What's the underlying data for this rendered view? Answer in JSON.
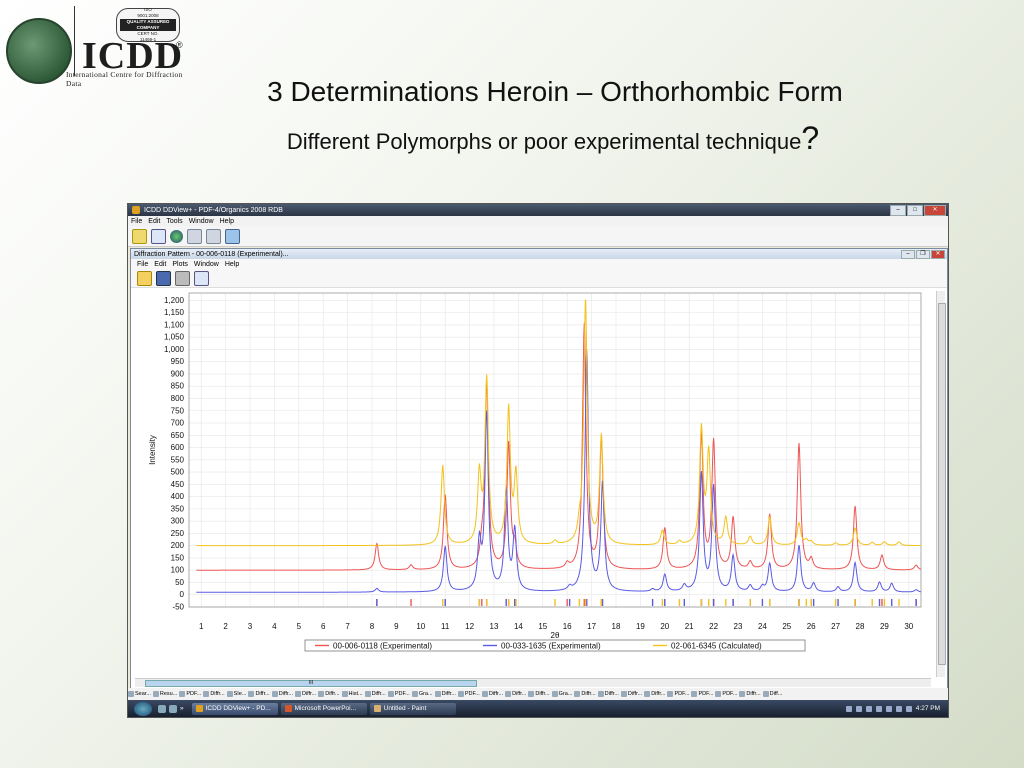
{
  "logo": {
    "brand": "ICDD",
    "tagline": "International Centre for Diffraction Data",
    "iso_badge": [
      "ISO",
      "9001:2008",
      "QUALITY ASSURED COMPANY",
      "CERT NO.",
      "11469-1"
    ]
  },
  "slide": {
    "title": "3 Determinations Heroin – Orthorhombic Form",
    "subtitle": "Different Polymorphs or poor experimental technique",
    "subtitle_mark": "?"
  },
  "app": {
    "title": "ICDD DDView+ - PDF-4/Organics 2008 RDB",
    "menu": [
      "File",
      "Edit",
      "Tools",
      "Window",
      "Help"
    ],
    "inner_title": "Diffraction Pattern - 00-006-0118 (Experimental)...",
    "inner_menu": [
      "File",
      "Edit",
      "Plots",
      "Window",
      "Help"
    ],
    "hscroll_label": "III"
  },
  "tabs": [
    "Sear...",
    "Resu...",
    "PDF...",
    "Diffr...",
    "SIe...",
    "Diffr...",
    "Diffr...",
    "Diffr...",
    "Diffr...",
    "Hist...",
    "Diffr...",
    "PDF...",
    "Gra...",
    "Diffr...",
    "PDF...",
    "Diffr...",
    "Diffr...",
    "Diffr...",
    "Gra...",
    "Diffr...",
    "Diffr...",
    "Diffr...",
    "Diffr...",
    "PDF...",
    "PDF...",
    "PDF...",
    "Diffr...",
    "Diff..."
  ],
  "taskbar": {
    "items": [
      "ICDD DDView+ - PD...",
      "Microsoft PowerPoi...",
      "Untitled - Paint"
    ],
    "clock": "4:27 PM",
    "chevron": "»"
  },
  "colors": {
    "series1": "#ee5555",
    "series2": "#5a5ae6",
    "series3": "#f3c21b"
  },
  "chart_data": {
    "type": "line",
    "xlabel": "2θ",
    "ylabel": "Intensity",
    "xlim": [
      0.5,
      30.5
    ],
    "ylim": [
      -50,
      1230
    ],
    "xticks": [
      1,
      2,
      3,
      4,
      5,
      6,
      7,
      8,
      9,
      10,
      11,
      12,
      13,
      14,
      15,
      16,
      17,
      18,
      19,
      20,
      21,
      22,
      23,
      24,
      25,
      26,
      27,
      28,
      29,
      30
    ],
    "yticks": [
      -50,
      0,
      50,
      100,
      150,
      200,
      250,
      300,
      350,
      400,
      450,
      500,
      550,
      600,
      650,
      700,
      750,
      800,
      850,
      900,
      950,
      1000,
      1050,
      1100,
      1150,
      1200
    ],
    "grid": true,
    "legend_position": "bottom",
    "series": [
      {
        "name": "00-006-0118 (Experimental)",
        "baseline": 100,
        "peaks": [
          [
            8.2,
            108
          ],
          [
            9.6,
            20
          ],
          [
            11.0,
            305
          ],
          [
            12.5,
            70
          ],
          [
            12.7,
            755
          ],
          [
            13.6,
            510
          ],
          [
            13.85,
            80
          ],
          [
            16.0,
            20
          ],
          [
            16.7,
            1000
          ],
          [
            17.4,
            535
          ],
          [
            20.0,
            170
          ],
          [
            21.5,
            550
          ],
          [
            22.0,
            520
          ],
          [
            22.8,
            210
          ],
          [
            23.5,
            30
          ],
          [
            24.3,
            225
          ],
          [
            25.5,
            515
          ],
          [
            26.0,
            40
          ],
          [
            27.8,
            260
          ],
          [
            28.9,
            60
          ],
          [
            30.3,
            20
          ]
        ]
      },
      {
        "name": "00-033-1635 (Experimental)",
        "baseline": 10,
        "peaks": [
          [
            8.2,
            15
          ],
          [
            11.0,
            185
          ],
          [
            12.4,
            190
          ],
          [
            12.7,
            720
          ],
          [
            13.5,
            410
          ],
          [
            13.85,
            245
          ],
          [
            16.1,
            15
          ],
          [
            16.8,
            980
          ],
          [
            17.45,
            440
          ],
          [
            19.5,
            10
          ],
          [
            20.0,
            70
          ],
          [
            20.8,
            25
          ],
          [
            21.5,
            480
          ],
          [
            22.0,
            425
          ],
          [
            22.8,
            145
          ],
          [
            23.5,
            25
          ],
          [
            24.0,
            20
          ],
          [
            24.3,
            115
          ],
          [
            25.5,
            190
          ],
          [
            26.1,
            35
          ],
          [
            27.1,
            20
          ],
          [
            27.8,
            120
          ],
          [
            28.8,
            40
          ],
          [
            29.3,
            35
          ],
          [
            30.3,
            10
          ]
        ]
      },
      {
        "name": "02-061-6345 (Calculated)",
        "baseline": 200,
        "peaks": [
          [
            10.9,
            325
          ],
          [
            12.4,
            280
          ],
          [
            12.7,
            670
          ],
          [
            13.6,
            550
          ],
          [
            13.9,
            280
          ],
          [
            15.5,
            15
          ],
          [
            16.5,
            50
          ],
          [
            16.75,
            1000
          ],
          [
            17.4,
            440
          ],
          [
            19.9,
            60
          ],
          [
            20.6,
            15
          ],
          [
            21.5,
            470
          ],
          [
            21.8,
            370
          ],
          [
            22.5,
            110
          ],
          [
            23.5,
            35
          ],
          [
            24.3,
            115
          ],
          [
            25.5,
            90
          ],
          [
            25.8,
            20
          ],
          [
            26.0,
            15
          ],
          [
            27.0,
            10
          ],
          [
            27.8,
            70
          ],
          [
            28.5,
            12
          ],
          [
            29.0,
            15
          ],
          [
            29.6,
            15
          ]
        ]
      }
    ]
  }
}
